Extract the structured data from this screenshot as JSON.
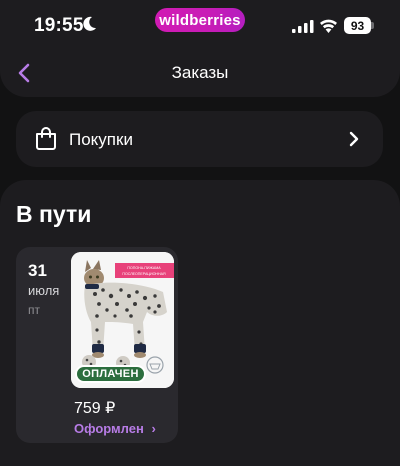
{
  "status_bar": {
    "time": "19:55",
    "battery": "93",
    "icons": [
      "moon-icon",
      "signal-icon",
      "wifi-icon",
      "battery-icon"
    ]
  },
  "brand": {
    "name": "wildberries",
    "color": "#cb11ab"
  },
  "header": {
    "title": "Заказы",
    "back_icon": "chevron-left-icon"
  },
  "purchases": {
    "label": "Покупки",
    "icon": "shopping-bag-icon",
    "chevron": "chevron-right-icon"
  },
  "in_transit": {
    "title": "В пути",
    "orders": [
      {
        "day": "31",
        "month": "июля",
        "weekday": "пт",
        "badge": "ОПЛАЧЕН",
        "price": "759 ₽",
        "status": "Оформлен",
        "status_color": "#b77ce6",
        "product_tag": "ПОПОНА-ПИЖАМА ПОСЛЕОПЕРАЦИОННАЯ"
      }
    ]
  },
  "colors": {
    "background": "#121213",
    "surface": "#1d1c1f",
    "card": "#2a292e",
    "accent": "#b77ce6",
    "paid": "#2c6e3e"
  }
}
